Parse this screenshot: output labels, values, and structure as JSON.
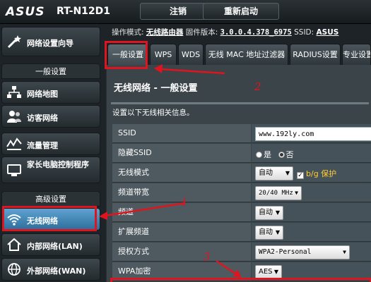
{
  "header": {
    "brand": "ASUS",
    "model": "RT-N12D1",
    "logout_label": "注销",
    "reboot_label": "重新启动"
  },
  "status": {
    "mode_label": "操作模式:",
    "mode_value": "无线路由器",
    "fw_label": "固件版本:",
    "fw_value": "3.0.0.4.378_6975",
    "ssid_label": "SSID:",
    "ssid_value": "ASUS"
  },
  "sidebar": {
    "wizard": "网络设置向导",
    "general_header": "一般设置",
    "general_items": [
      "网络地图",
      "访客网络",
      "流量管理",
      "家长电脑控制程序"
    ],
    "advanced_header": "高级设置",
    "advanced_items": [
      "无线网络",
      "内部网络(LAN)",
      "外部网络(WAN)"
    ]
  },
  "tabs": [
    "一般设置",
    "WPS",
    "WDS",
    "无线 MAC 地址过滤器",
    "RADIUS设置",
    "专业设置"
  ],
  "panel": {
    "title": "无线网络 - 一般设置",
    "description": "设置以下无线相关信息。",
    "rows": [
      {
        "label": "SSID",
        "value": "www.192ly.com"
      },
      {
        "label": "隐藏SSID",
        "yes": "是",
        "no": "否"
      },
      {
        "label": "无线模式",
        "value": "自动",
        "extra": "b/g 保护"
      },
      {
        "label": "频道带宽",
        "value": "20/40 MHz"
      },
      {
        "label": "频道",
        "value": "自动"
      },
      {
        "label": "扩展频道",
        "value": "自动"
      },
      {
        "label": "授权方式",
        "value": "WPA2-Personal"
      },
      {
        "label": "WPA加密",
        "value": "AES"
      }
    ]
  },
  "annotations": [
    "1",
    "2",
    "3"
  ],
  "colors": {
    "annotation": "#e0141e",
    "active": "#3f88bf",
    "bg_protect": "#ffcc33"
  }
}
